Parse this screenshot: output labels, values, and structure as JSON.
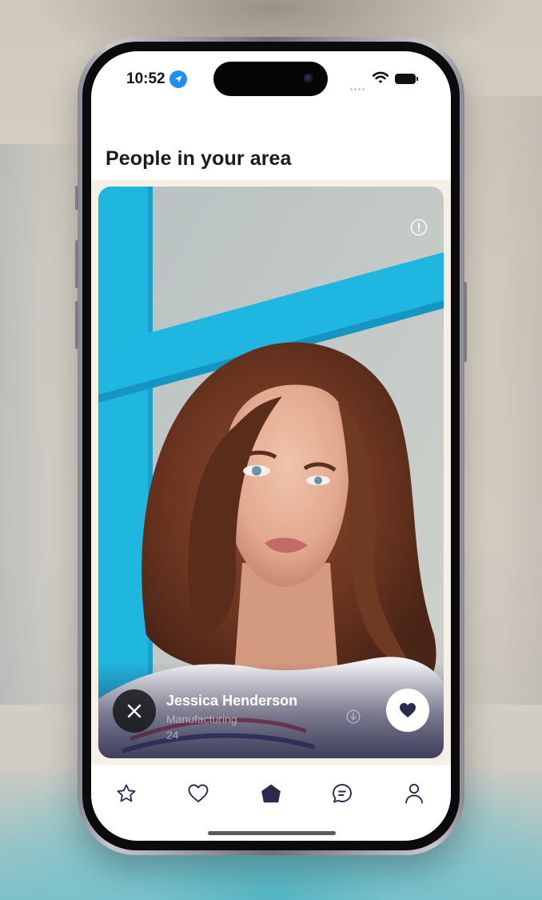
{
  "status_bar": {
    "time": "10:52"
  },
  "page": {
    "title": "People in your area"
  },
  "profile_card": {
    "name": "Jessica Henderson",
    "occupation": "Manufacturing",
    "age": "24"
  },
  "tab_bar": {
    "items": [
      {
        "icon": "star-icon"
      },
      {
        "icon": "heart-icon"
      },
      {
        "icon": "home-icon",
        "active": true
      },
      {
        "icon": "chat-icon"
      },
      {
        "icon": "profile-icon"
      }
    ]
  },
  "colors": {
    "accent": "#2b2a4c",
    "title_text": "#1a1a1f",
    "content_background": "#f6efe6",
    "photo_frame_blue": "#1fb6e0"
  }
}
